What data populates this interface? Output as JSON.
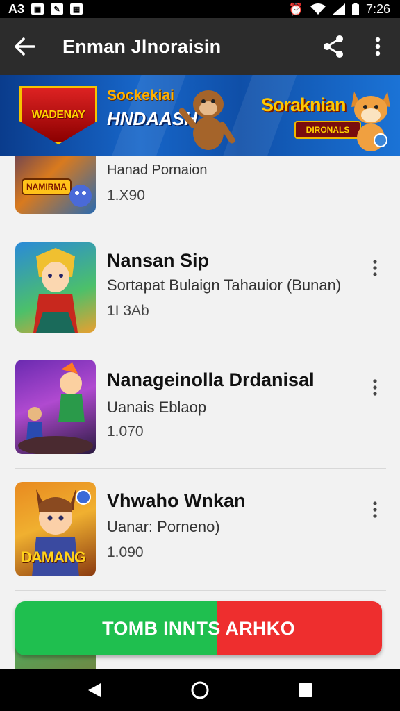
{
  "status_bar": {
    "left_text": "A3",
    "time": "7:26",
    "icons": [
      "image-icon",
      "document-icon",
      "gallery-icon",
      "alarm-icon",
      "wifi-icon",
      "signal-icon",
      "battery-icon"
    ]
  },
  "app_bar": {
    "title": "Enman Jlnoraisin",
    "icons": [
      "back-arrow-icon",
      "share-icon",
      "more-vert-icon"
    ]
  },
  "banner": {
    "shield_text": "WADENAY",
    "left_line1": "Sockekiai",
    "left_line2": "HNDAASH",
    "right_title": "Soraknian",
    "right_badge": "DIRONALS"
  },
  "list": {
    "items": [
      {
        "title": "",
        "subtitle": "Hanad Pornaion",
        "count": "1.X90",
        "thumb_label": "NAMIRMA"
      },
      {
        "title": "Nansan Sip",
        "subtitle": "Sortapat Bulaign Tahauior (Bunan)",
        "count": "1I 3Ab",
        "thumb_label": ""
      },
      {
        "title": "Nanageinolla Drdanisal",
        "subtitle": "Uanais Eblaop",
        "count": "1.070",
        "thumb_label": ""
      },
      {
        "title": "Vhwaho Wnkan",
        "subtitle": "Uanar: Porneno)",
        "count": "1.090",
        "thumb_label": "DAMANG"
      }
    ]
  },
  "cta": {
    "label": "TOMB INNTS ARHKO"
  },
  "colors": {
    "app_bar": "#2c2c2c",
    "cta_green": "#1fbf4f",
    "cta_red": "#ee2e2e",
    "banner_blue": "#1766c9"
  },
  "nav_bar": {
    "icons": [
      "back-triangle-icon",
      "home-circle-icon",
      "recents-square-icon"
    ]
  }
}
